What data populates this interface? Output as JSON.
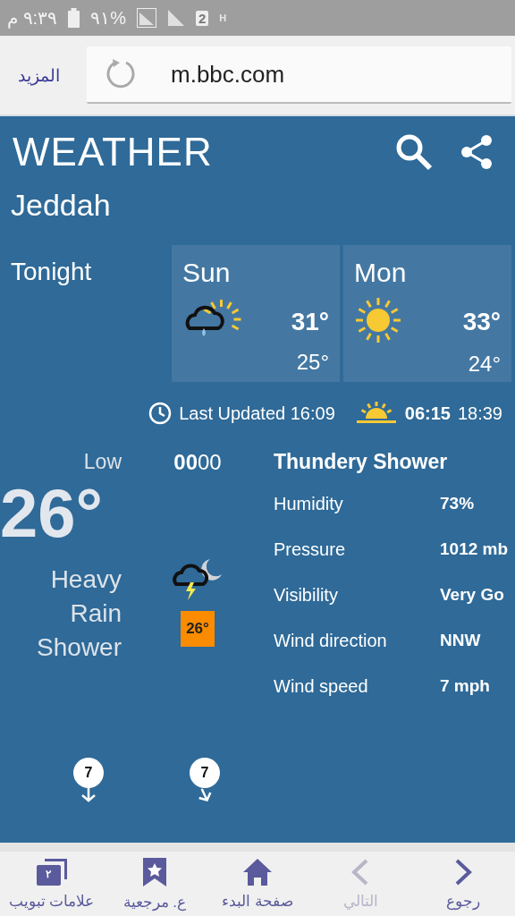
{
  "status_bar": {
    "time": "٩:٣٩ م",
    "battery": "%٩١",
    "sim": "2",
    "network": "H"
  },
  "browser": {
    "more": "المزيد",
    "url": "m.bbc.com"
  },
  "header": {
    "logo": "WEATHER"
  },
  "location": "Jeddah",
  "tonight": "Tonight",
  "days": [
    {
      "name": "Sun",
      "kind": "rain-sun",
      "high": "31°",
      "low": "25°"
    },
    {
      "name": "Mon",
      "kind": "sun",
      "high": "33°",
      "low": "24°"
    }
  ],
  "updated": {
    "text": "Last Updated 16:09",
    "sunrise": "06:15",
    "sunset": "18:39"
  },
  "current": {
    "label": "Low",
    "temp": "26°",
    "description": "Heavy Rain Shower"
  },
  "hour": {
    "time": "**00**00",
    "kind": "thunder-moon",
    "temp": "26°"
  },
  "details": {
    "title": "Thundery Shower",
    "rows": [
      {
        "label": "Humidity",
        "value": "73%"
      },
      {
        "label": "Pressure",
        "value": "1012 mb"
      },
      {
        "label": "Visibility",
        "value": "Very Go"
      },
      {
        "label": "Wind direction",
        "value": "NNW"
      },
      {
        "label": "Wind speed",
        "value": "7 mph"
      }
    ]
  },
  "wind": [
    {
      "speed": "7"
    },
    {
      "speed": "7"
    }
  ],
  "nav": [
    {
      "label": "رجوع",
      "kind": "next",
      "disabled": false
    },
    {
      "label": "التالي",
      "kind": "prev",
      "disabled": true
    },
    {
      "label": "صفحة البدء",
      "kind": "home",
      "disabled": false
    },
    {
      "label": "ع. مرجعية",
      "kind": "bookmark",
      "disabled": false
    },
    {
      "label": "علامات تبويب",
      "kind": "tabs",
      "disabled": false,
      "badge": "٢"
    }
  ]
}
